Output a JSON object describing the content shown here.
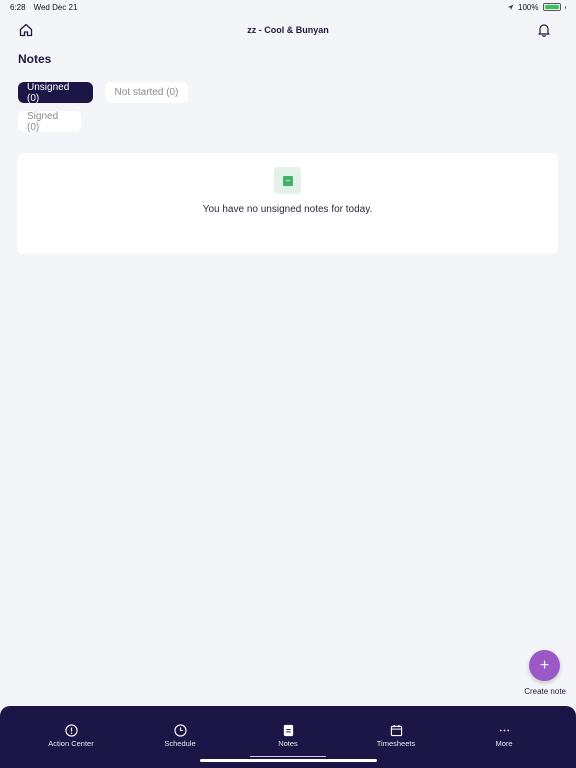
{
  "status_bar": {
    "time": "6:28",
    "date": "Wed Dec 21",
    "battery": "100%",
    "battery_level": 1.0
  },
  "header": {
    "title": "zz - Cool & Bunyan",
    "home_icon": "home-icon",
    "bell_icon": "bell-icon"
  },
  "page": {
    "title": "Notes"
  },
  "filters": [
    {
      "label": "Unsigned (0)",
      "active": true
    },
    {
      "label": "Not started (0)",
      "active": false
    },
    {
      "label": "Signed (0)",
      "active": false
    }
  ],
  "empty_state": {
    "icon": "note-icon",
    "message": "You have no unsigned notes for today."
  },
  "fab": {
    "symbol": "+",
    "label": "Create note"
  },
  "bottom_nav": {
    "items": [
      {
        "label": "Action Center",
        "icon": "alert-circle-icon"
      },
      {
        "label": "Schedule",
        "icon": "clock-icon"
      },
      {
        "label": "Notes",
        "icon": "notes-icon"
      },
      {
        "label": "Timesheets",
        "icon": "calendar-icon"
      },
      {
        "label": "More",
        "icon": "more-icon"
      }
    ],
    "active_index": 2
  },
  "colors": {
    "primary_dark": "#1c1647",
    "accent_purple": "#9b59c8",
    "background": "#f4f5f8",
    "success_green": "#3fb36a"
  }
}
